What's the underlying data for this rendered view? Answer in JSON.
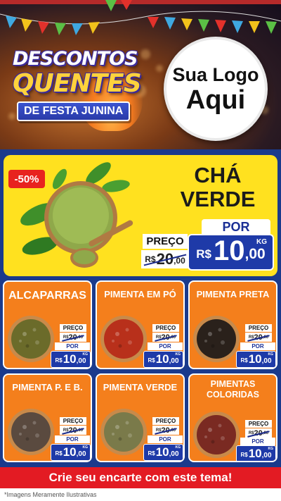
{
  "header": {
    "title_line1": "DESCONTOS",
    "title_line2": "QUENTES",
    "subtitle": "DE FESTA JUNINA",
    "logo_line1": "Sua Logo",
    "logo_line2": "Aqui"
  },
  "featured": {
    "badge": "-50%",
    "title": "CHÁ VERDE",
    "old_label": "PREÇO",
    "old_currency": "R$",
    "old_int": "20",
    "old_dec": ",00",
    "new_label": "POR",
    "new_currency": "R$",
    "new_int": "10",
    "new_dec": ",00",
    "unit": "KG"
  },
  "products": [
    {
      "name": "ALCAPARRAS",
      "old_label": "PREÇO",
      "old_currency": "R$",
      "old_int": "20",
      "old_dec": ",00",
      "new_label": "POR",
      "new_currency": "R$",
      "new_int": "10",
      "new_dec": ",00",
      "unit": "KG",
      "color": "#6b6b2a"
    },
    {
      "name": "PIMENTA EM PÓ",
      "old_label": "PREÇO",
      "old_currency": "R$",
      "old_int": "20",
      "old_dec": ",00",
      "new_label": "POR",
      "new_currency": "R$",
      "new_int": "10",
      "new_dec": ",00",
      "unit": "KG",
      "color": "#b8301b"
    },
    {
      "name": "PIMENTA PRETA",
      "old_label": "PREÇO",
      "old_currency": "R$",
      "old_int": "20",
      "old_dec": ",00",
      "new_label": "POR",
      "new_currency": "R$",
      "new_int": "10",
      "new_dec": ",00",
      "unit": "KG",
      "color": "#2a211b"
    },
    {
      "name": "PIMENTA P. E B.",
      "old_label": "PREÇO",
      "old_currency": "R$",
      "old_int": "20",
      "old_dec": ",00",
      "new_label": "POR",
      "new_currency": "R$",
      "new_int": "10",
      "new_dec": ",00",
      "unit": "KG",
      "color": "#5a4a3f"
    },
    {
      "name": "PIMENTA VERDE",
      "old_label": "PREÇO",
      "old_currency": "R$",
      "old_int": "20",
      "old_dec": ",00",
      "new_label": "POR",
      "new_currency": "R$",
      "new_int": "10",
      "new_dec": ",00",
      "unit": "KG",
      "color": "#7a7a4a"
    },
    {
      "name": "PIMENTAS COLORIDAS",
      "old_label": "PREÇO",
      "old_currency": "R$",
      "old_int": "20",
      "old_dec": ",00",
      "new_label": "POR",
      "new_currency": "R$",
      "new_int": "10",
      "new_dec": ",00",
      "unit": "KG",
      "color": "#7a2a22"
    }
  ],
  "footer": {
    "cta": "Crie seu encarte com este tema!",
    "note": "*Imagens Meramente Ilustrativas"
  },
  "colors": {
    "background": "#1a3a8c",
    "featured_bg": "#ffe11f",
    "card_bg": "#f47f1c",
    "price_blue": "#1e3aa8",
    "badge_red": "#e8231f",
    "cta_red": "#e31b23"
  }
}
